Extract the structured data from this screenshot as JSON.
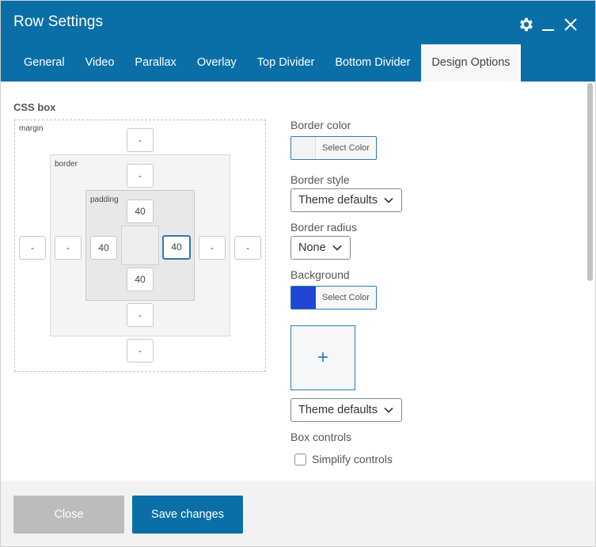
{
  "window": {
    "title": "Row Settings",
    "accent": "#0a6fa6"
  },
  "header_icons": [
    "gear-icon",
    "minimize-icon",
    "close-icon"
  ],
  "tabs": [
    {
      "label": "General"
    },
    {
      "label": "Video"
    },
    {
      "label": "Parallax"
    },
    {
      "label": "Overlay"
    },
    {
      "label": "Top Divider"
    },
    {
      "label": "Bottom Divider"
    },
    {
      "label": "Design Options",
      "active": true
    }
  ],
  "css_box": {
    "title": "CSS box",
    "margin_label": "margin",
    "border_label": "border",
    "padding_label": "padding",
    "margin": {
      "top": "-",
      "right": "-",
      "bottom": "-",
      "left": "-"
    },
    "border": {
      "top": "-",
      "right": "-",
      "bottom": "-",
      "left": "-"
    },
    "padding": {
      "top": "40",
      "right": "40",
      "bottom": "40",
      "left": "40"
    }
  },
  "design": {
    "border_color": {
      "label": "Border color",
      "button": "Select Color",
      "swatch": "#f3f3f3"
    },
    "border_style": {
      "label": "Border style",
      "value": "Theme defaults"
    },
    "border_radius": {
      "label": "Border radius",
      "value": "None"
    },
    "background": {
      "label": "Background",
      "button": "Select Color",
      "swatch": "#2146d4"
    },
    "add_image": {
      "glyph": "+"
    },
    "background_style": {
      "value": "Theme defaults"
    },
    "box_controls": {
      "label": "Box controls",
      "checkbox_label": "Simplify controls",
      "checked": false
    }
  },
  "footer": {
    "close": "Close",
    "save": "Save changes"
  }
}
